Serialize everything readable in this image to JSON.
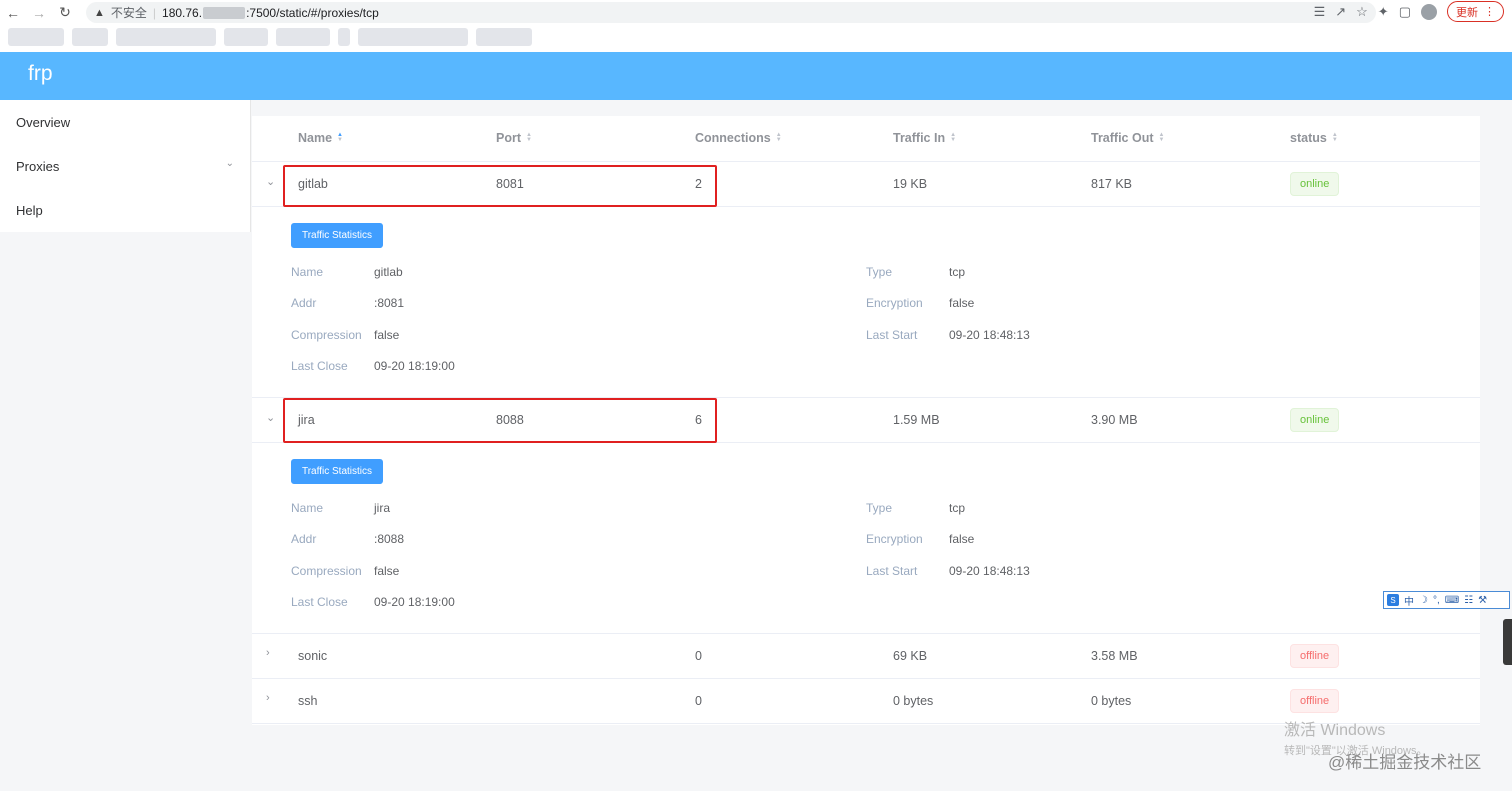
{
  "browser": {
    "insecure_label": "不安全",
    "url_prefix": "180.76.",
    "url_suffix": ":7500/static/#/proxies/tcp",
    "update_label": "更新"
  },
  "app": {
    "brand": "frp"
  },
  "sidebar": {
    "items": [
      {
        "label": "Overview"
      },
      {
        "label": "Proxies"
      },
      {
        "label": "Help"
      }
    ]
  },
  "table": {
    "columns": [
      "Name",
      "Port",
      "Connections",
      "Traffic In",
      "Traffic Out",
      "status"
    ],
    "rows": [
      {
        "name": "gitlab",
        "port": "8081",
        "connections": "2",
        "traffic_in": "19 KB",
        "traffic_out": "817 KB",
        "status": "online",
        "detail": {
          "button": "Traffic Statistics",
          "labels": {
            "name": "Name",
            "addr": "Addr",
            "compression": "Compression",
            "last_close": "Last Close",
            "type": "Type",
            "encryption": "Encryption",
            "last_start": "Last Start"
          },
          "name": "gitlab",
          "addr": ":8081",
          "compression": "false",
          "last_close": "09-20 18:19:00",
          "type": "tcp",
          "encryption": "false",
          "last_start": "09-20 18:48:13"
        }
      },
      {
        "name": "jira",
        "port": "8088",
        "connections": "6",
        "traffic_in": "1.59 MB",
        "traffic_out": "3.90 MB",
        "status": "online",
        "detail": {
          "button": "Traffic Statistics",
          "labels": {
            "name": "Name",
            "addr": "Addr",
            "compression": "Compression",
            "last_close": "Last Close",
            "type": "Type",
            "encryption": "Encryption",
            "last_start": "Last Start"
          },
          "name": "jira",
          "addr": ":8088",
          "compression": "false",
          "last_close": "09-20 18:19:00",
          "type": "tcp",
          "encryption": "false",
          "last_start": "09-20 18:48:13"
        }
      },
      {
        "name": "sonic",
        "port": "",
        "connections": "0",
        "traffic_in": "69 KB",
        "traffic_out": "3.58 MB",
        "status": "offline"
      },
      {
        "name": "ssh",
        "port": "",
        "connections": "0",
        "traffic_in": "0 bytes",
        "traffic_out": "0 bytes",
        "status": "offline"
      }
    ]
  },
  "overlays": {
    "ime_chinese": "中",
    "activation_title": "激活 Windows",
    "activation_sub": "转到\"设置\"以激活 Windows。",
    "credit": "@稀土掘金技术社区"
  },
  "colors": {
    "header": "#58b7ff",
    "primary": "#409eff",
    "online": "#67c23a",
    "offline": "#f56c6c",
    "highlight": "#e02020"
  }
}
